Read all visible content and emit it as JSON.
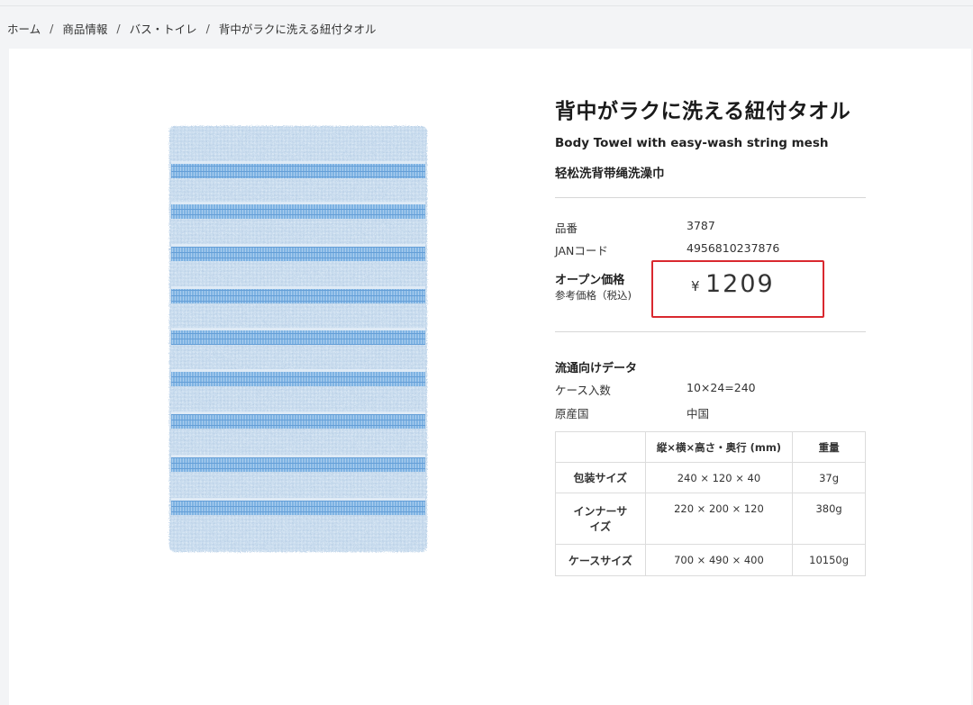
{
  "breadcrumb": {
    "items": [
      "ホーム",
      "商品情報",
      "バス・トイレ",
      "背中がラクに洗える紐付タオル"
    ],
    "separator": "/"
  },
  "product": {
    "title_ja": "背中がラクに洗える紐付タオル",
    "title_en": "Body Towel with easy-wash string mesh",
    "title_zh": "轻松洗背带绳洗澡巾",
    "image_alt": "towel-image",
    "specs": [
      {
        "key": "品番",
        "value": "3787"
      },
      {
        "key": "JANコード",
        "value": "4956810237876"
      }
    ],
    "price": {
      "label": "オープン価格",
      "sub_label": "参考価格（税込)",
      "currency": "¥",
      "amount": "1209",
      "highlight_color": "#d9282f"
    }
  },
  "distribution": {
    "heading": "流通向けデータ",
    "rows": [
      {
        "key": "ケース入数",
        "value": "10×24=240"
      },
      {
        "key": "原産国",
        "value": "中国"
      }
    ],
    "table": {
      "headers": [
        "",
        "縦×横×高さ・奥行 (mm)",
        "重量"
      ],
      "rows": [
        {
          "name": "包装サイズ",
          "size": "240 × 120 × 40",
          "weight": "37g"
        },
        {
          "name": "インナーサイズ",
          "size": "220 × 200 × 120",
          "weight": "380g"
        },
        {
          "name": "ケースサイズ",
          "size": "700 × 490 × 400",
          "weight": "10150g"
        }
      ]
    }
  },
  "colors": {
    "towel_base": "#c9dcee",
    "towel_stripe": "#6fa8de",
    "page_bg": "#f3f4f6"
  }
}
